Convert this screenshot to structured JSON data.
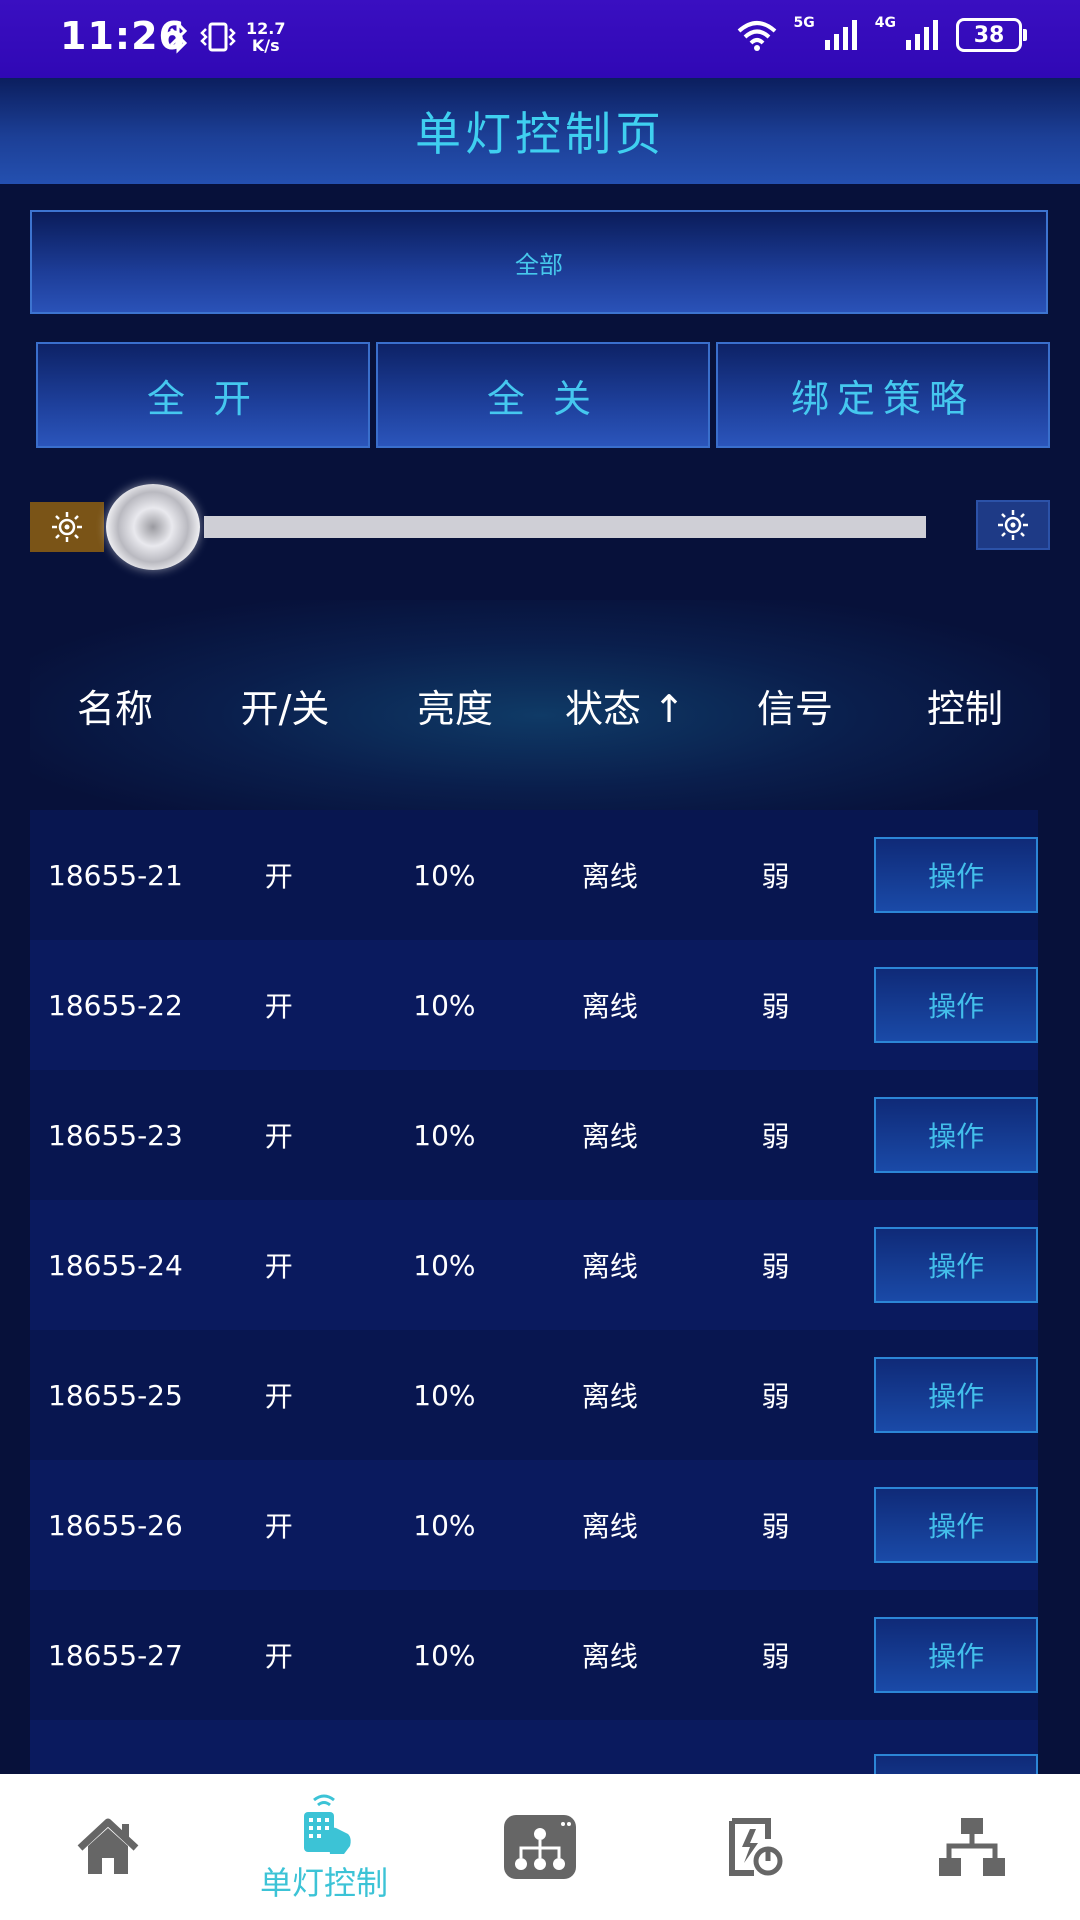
{
  "status_bar": {
    "time": "11:26",
    "speed_value": "12.7",
    "speed_unit": "K/s",
    "net1": "5G",
    "net2": "4G",
    "battery": "38"
  },
  "header": {
    "title": "单灯控制页"
  },
  "filter": {
    "label": "全部"
  },
  "actions": {
    "all_on": "全 开",
    "all_off": "全 关",
    "bind_policy": "绑定策略"
  },
  "slider": {
    "brightness_fraction": 0.0
  },
  "table": {
    "headers": [
      "名称",
      "开/关",
      "亮度",
      "状态 ↑",
      "信号",
      "控制"
    ],
    "rows": [
      {
        "name": "18655-21",
        "power": "开",
        "brightness": "10%",
        "status": "离线",
        "signal": "弱",
        "action": "操作"
      },
      {
        "name": "18655-22",
        "power": "开",
        "brightness": "10%",
        "status": "离线",
        "signal": "弱",
        "action": "操作"
      },
      {
        "name": "18655-23",
        "power": "开",
        "brightness": "10%",
        "status": "离线",
        "signal": "弱",
        "action": "操作"
      },
      {
        "name": "18655-24",
        "power": "开",
        "brightness": "10%",
        "status": "离线",
        "signal": "弱",
        "action": "操作"
      },
      {
        "name": "18655-25",
        "power": "开",
        "brightness": "10%",
        "status": "离线",
        "signal": "弱",
        "action": "操作"
      },
      {
        "name": "18655-26",
        "power": "开",
        "brightness": "10%",
        "status": "离线",
        "signal": "弱",
        "action": "操作"
      },
      {
        "name": "18655-27",
        "power": "开",
        "brightness": "10%",
        "status": "离线",
        "signal": "弱",
        "action": "操作"
      }
    ]
  },
  "bottom_nav": {
    "items": [
      {
        "icon": "home-icon",
        "label": ""
      },
      {
        "icon": "lamp-control-icon",
        "label": "单灯控制",
        "active": true
      },
      {
        "icon": "topology-icon",
        "label": ""
      },
      {
        "icon": "power-report-icon",
        "label": ""
      },
      {
        "icon": "network-icon",
        "label": ""
      }
    ]
  },
  "colors": {
    "accent": "#3fd0f0",
    "background": "#07113a",
    "status_bar": "#3008b5",
    "nav_active": "#3cc3d6",
    "nav_icon": "#666666"
  }
}
